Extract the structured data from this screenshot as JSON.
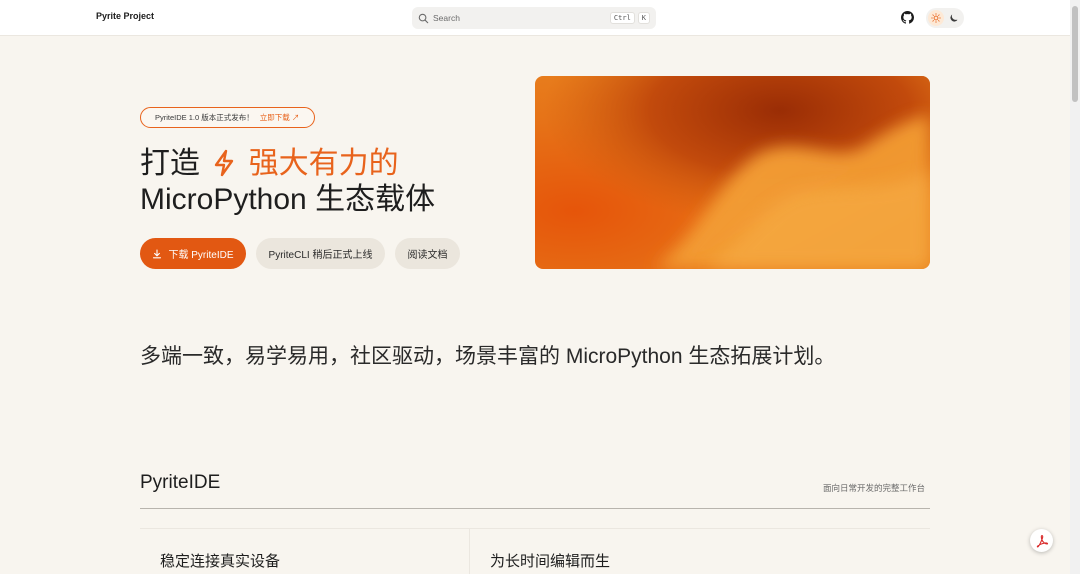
{
  "header": {
    "brand": "Pyrite Project",
    "search": {
      "placeholder": "Search",
      "shortcut_keys": [
        "Ctrl",
        "K"
      ]
    },
    "icons": [
      "github-icon",
      "sun-icon",
      "moon-icon"
    ]
  },
  "hero": {
    "announcement": {
      "text": "PyriteIDE 1.0 版本正式发布！",
      "link": "立即下载 ↗"
    },
    "title": {
      "prefix": "打造",
      "highlight": "强大有力的",
      "line2": "MicroPython 生态载体"
    },
    "buttons": {
      "download": "下载 PyriteIDE",
      "cli": "PyriteCLI 稍后正式上线",
      "docs": "阅读文档"
    }
  },
  "tagline": "多端一致，易学易用，社区驱动，场景丰富的 MicroPython 生态拓展计划。",
  "section": {
    "title": "PyriteIDE",
    "subtitle": "面向日常开发的完整工作台",
    "cards": [
      "稳定连接真实设备",
      "为长时间编辑而生"
    ]
  },
  "colors": {
    "accent": "#e8631c",
    "background": "#f8f5ef",
    "button_primary": "#e25812"
  }
}
